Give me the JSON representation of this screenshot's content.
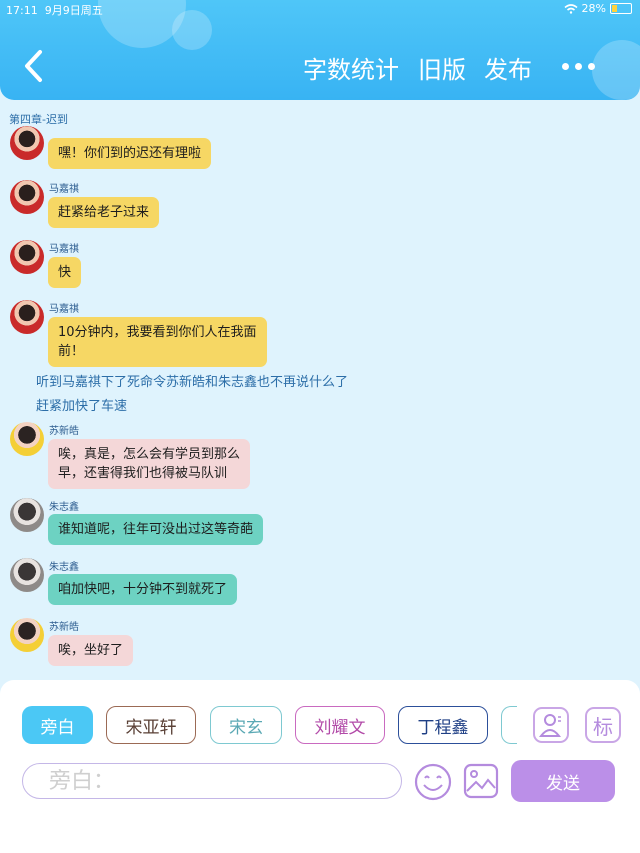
{
  "status_bar": {
    "time": "17:11",
    "date": "9月9日周五",
    "battery": "28%"
  },
  "topbar": {
    "word_count": "字数统计",
    "old_version": "旧版",
    "publish": "发布"
  },
  "chapter_title": "第四章-迟到",
  "messages": [
    {
      "speaker": "",
      "text": "嘿！你们到的迟还有理啦"
    },
    {
      "speaker": "马嘉祺",
      "text": "赶紧给老子过来"
    },
    {
      "speaker": "马嘉祺",
      "text": "快"
    },
    {
      "speaker": "马嘉祺",
      "line1": "10分钟内，我要看到你们人在我面",
      "line2": "前！"
    },
    {
      "narration1": "听到马嘉祺下了死命令苏新皓和朱志鑫也不再说什么了",
      "narration2": "赶紧加快了车速"
    },
    {
      "speaker": "苏新皓",
      "line1": "唉，真是，怎么会有学员到那么",
      "line2": "早，还害得我们也得被马队训"
    },
    {
      "speaker": "朱志鑫",
      "text": "谁知道呢，往年可没出过这等奇葩"
    },
    {
      "speaker": "朱志鑫",
      "text": "咱加快吧，十分钟不到就死了"
    },
    {
      "speaker": "苏新皓",
      "text": "唉，坐好了"
    }
  ],
  "roles": [
    "旁白",
    "宋亚轩",
    "宋玄",
    "刘耀文",
    "丁程鑫"
  ],
  "role_colors": [
    "#4bc8f5",
    "#9b6a55",
    "#7ec9d1",
    "#c96ac0",
    "#2c4f9a"
  ],
  "mark_label": "标",
  "input": {
    "placeholder": "旁白："
  },
  "send_label": "发送"
}
